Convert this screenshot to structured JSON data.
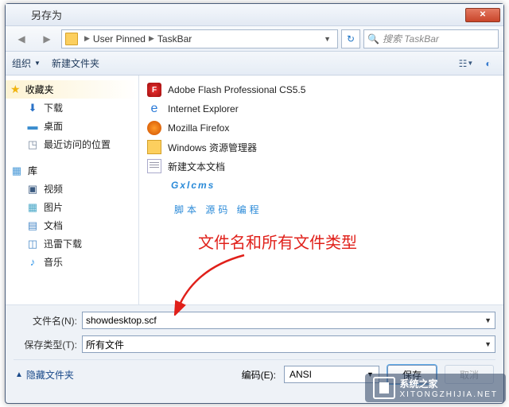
{
  "window": {
    "title": "另存为"
  },
  "nav": {
    "breadcrumb": [
      "User Pinned",
      "TaskBar"
    ],
    "search_placeholder": "搜索 TaskBar"
  },
  "toolbar": {
    "organize": "组织",
    "new_folder": "新建文件夹"
  },
  "sidebar": {
    "favorites_label": "收藏夹",
    "favorites": [
      {
        "label": "下载",
        "ico": "ico-dl",
        "glyph": "⬇"
      },
      {
        "label": "桌面",
        "ico": "ico-desk",
        "glyph": "▬"
      },
      {
        "label": "最近访问的位置",
        "ico": "ico-rec",
        "glyph": "◳"
      }
    ],
    "library_label": "库",
    "library": [
      {
        "label": "视频",
        "ico": "ico-vid",
        "glyph": "▣"
      },
      {
        "label": "图片",
        "ico": "ico-pic",
        "glyph": "▦"
      },
      {
        "label": "文档",
        "ico": "ico-doc",
        "glyph": "▤"
      },
      {
        "label": "迅雷下载",
        "ico": "ico-thd",
        "glyph": "◫"
      },
      {
        "label": "音乐",
        "ico": "ico-mus",
        "glyph": "♪"
      }
    ]
  },
  "files": [
    {
      "label": "Adobe Flash Professional CS5.5",
      "cls": "flash",
      "glyph": "F"
    },
    {
      "label": "Internet Explorer",
      "cls": "ie",
      "glyph": "e"
    },
    {
      "label": "Mozilla Firefox",
      "cls": "ff",
      "glyph": ""
    },
    {
      "label": "Windows 资源管理器",
      "cls": "explorer",
      "glyph": ""
    },
    {
      "label": "新建文本文档",
      "cls": "txt",
      "glyph": ""
    }
  ],
  "watermark": {
    "main": "Gxlcms",
    "sub": "脚本 源码 编程"
  },
  "annotation": "文件名和所有文件类型",
  "form": {
    "filename_label": "文件名(N):",
    "filename_value": "showdesktop.scf",
    "filetype_label": "保存类型(T):",
    "filetype_value": "所有文件",
    "hide_folders": "隐藏文件夹",
    "encoding_label": "编码(E):",
    "encoding_value": "ANSI",
    "save": "保存",
    "cancel": "取消"
  },
  "overlay": {
    "brand": "系统之家",
    "url": "XITONGZHIJIA.NET"
  }
}
